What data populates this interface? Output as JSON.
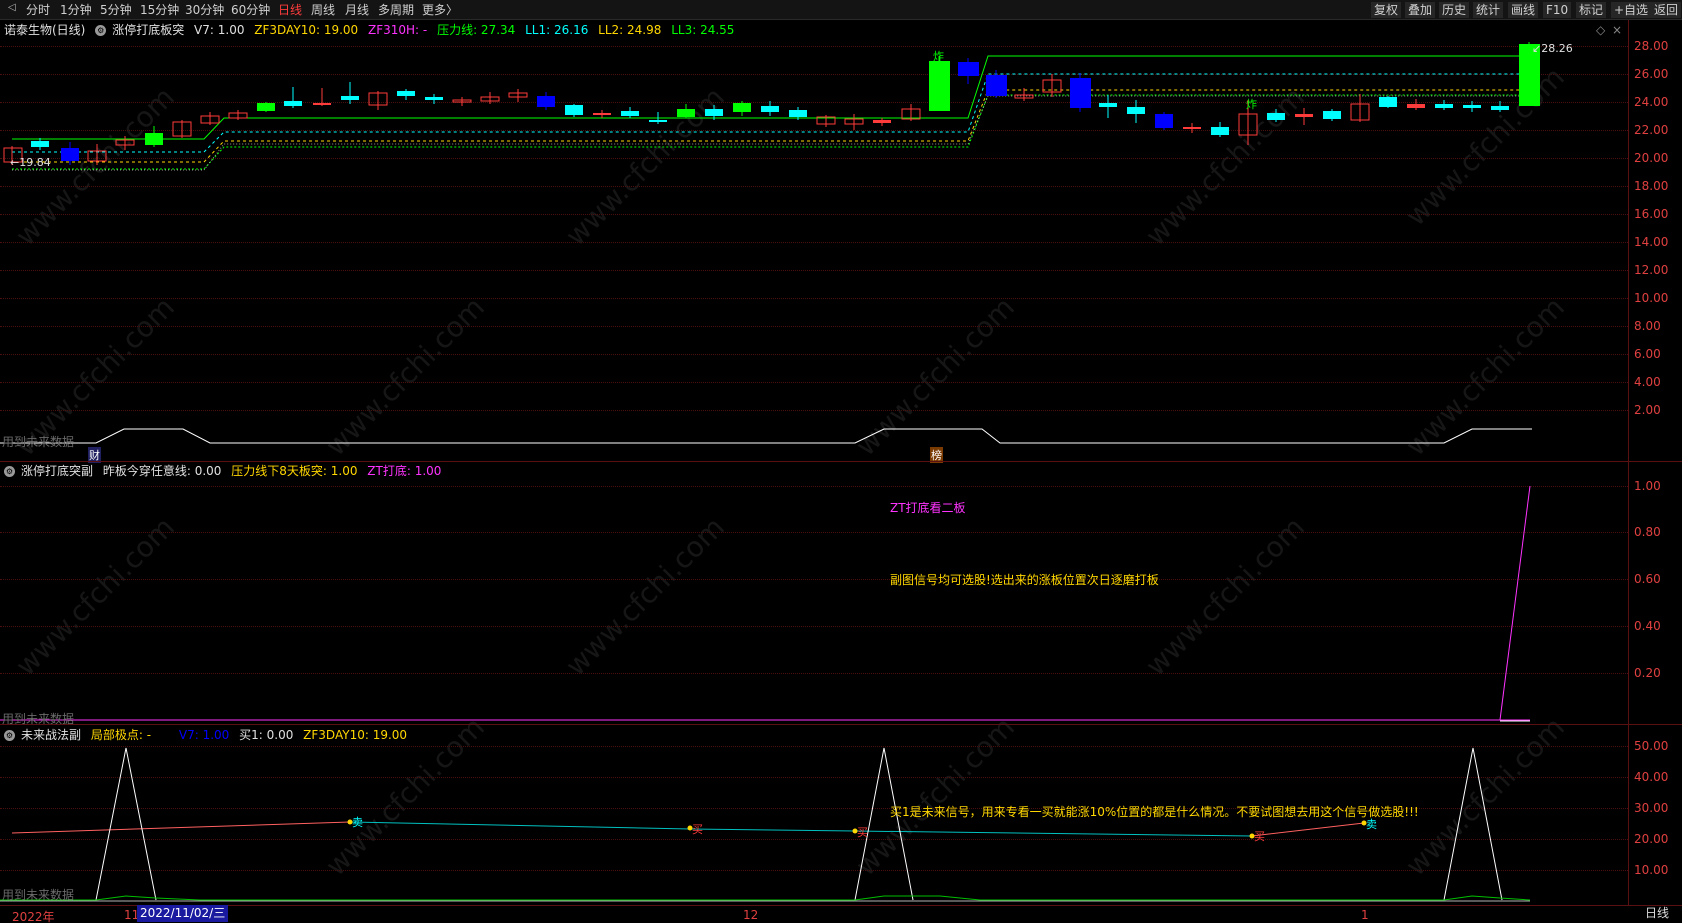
{
  "toolbar": {
    "periods": [
      "分时",
      "1分钟",
      "5分钟",
      "15分钟",
      "30分钟",
      "60分钟",
      "日线",
      "周线",
      "月线",
      "多周期",
      "更多〉"
    ],
    "active_period": "日线",
    "right_buttons": [
      "复权",
      "叠加",
      "历史",
      "统计",
      "画线",
      "F10",
      "标记",
      "+自选",
      "返回"
    ]
  },
  "main_panel": {
    "stock": "诺泰生物(日线)",
    "indicator": "涨停打底板突",
    "v7": "V7: 1.00",
    "zf3day10": "ZF3DAY10: 19.00",
    "zf310h": "ZF310H: -",
    "pressure": "压力线: 27.34",
    "ll1": "LL1: 26.16",
    "ll2": "LL2: 24.98",
    "ll3": "LL3: 24.55",
    "min_price_label": "19.84",
    "max_price_label": "28.26",
    "future_data": "用到未来数据",
    "tag_cai": "财",
    "tag_bang": "榜",
    "tag_zha": "炸",
    "y_labels": [
      "28.00",
      "26.00",
      "24.00",
      "22.00",
      "20.00",
      "18.00",
      "16.00",
      "14.00",
      "12.00",
      "10.00",
      "8.00",
      "6.00",
      "4.00",
      "2.00"
    ],
    "colors": {
      "up": "#ff3c3c",
      "down_cyan": "#00ffff",
      "down_blue": "#0000ff",
      "green_fill": "#00ff00",
      "pressure": "#00ff00"
    }
  },
  "sub_panel_1": {
    "indicator": "涨停打底突副",
    "line1": "昨板今穿任意线: 0.00",
    "line2": "压力线下8天板突: 1.00",
    "line3": "ZT打底: 1.00",
    "note1": "ZT打底看二板",
    "note2": "副图信号均可选股!选出来的涨板位置次日逐磨打板",
    "future_data": "用到未来数据",
    "y_labels": [
      "1.00",
      "0.80",
      "0.60",
      "0.40",
      "0.20"
    ]
  },
  "sub_panel_2": {
    "indicator": "未来战法副",
    "local_extreme": "局部极点: -",
    "v7": "V7: 1.00",
    "buy1": "买1: 0.00",
    "zf3day10": "ZF3DAY10: 19.00",
    "note": "买1是未来信号，用来专看一买就能涨10%位置的都是什么情况。不要试图想去用这个信号做选股!!!",
    "future_data": "用到未来数据",
    "sell_tag": "卖",
    "buy_tag": "买",
    "y_labels": [
      "50.00",
      "40.00",
      "30.00",
      "20.00",
      "10.00"
    ]
  },
  "x_axis": {
    "labels": [
      "2022年",
      "11",
      "12",
      "1"
    ],
    "cursor_date": "2022/11/02/三",
    "period": "日线"
  },
  "watermark": "www.cfchi.com"
}
